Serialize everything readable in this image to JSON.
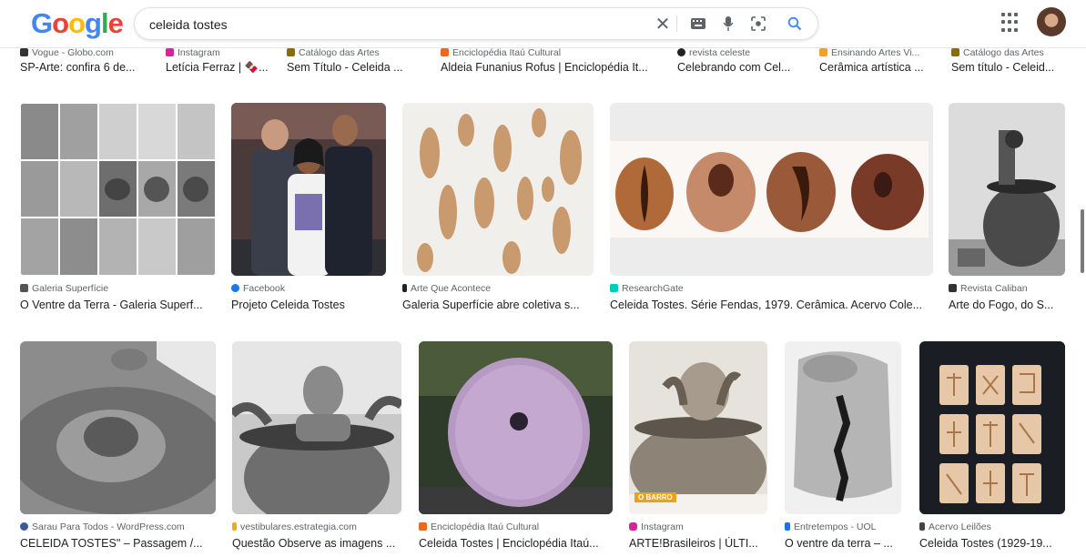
{
  "header": {
    "logo": [
      "G",
      "o",
      "o",
      "g",
      "l",
      "e"
    ],
    "query": "celeida tostes",
    "icons": [
      "close-icon",
      "keyboard-icon",
      "mic-icon",
      "lens-icon",
      "search-icon"
    ]
  },
  "top_strip": [
    {
      "source": "Vogue - Globo.com",
      "title": "SP-Arte: confira 6 de...",
      "dot": "#333333"
    },
    {
      "source": "Instagram",
      "title": "Letícia Ferraz | 🍫...",
      "dot": "#d6249f"
    },
    {
      "source": "Catálogo das Artes",
      "title": "Sem Título - Celeida ...",
      "dot": "#8a6d00"
    },
    {
      "source": "Enciclopédia Itaú Cultural",
      "title": "Aldeia Funanius Rofus | Enciclopédia It...",
      "dot": "#e86a20"
    },
    {
      "source": "revista celeste",
      "title": "Celebrando com Cel...",
      "dot": "#222222"
    },
    {
      "source": "Ensinando Artes Vi...",
      "title": "Cerâmica artística ...",
      "dot": "#f0a030"
    },
    {
      "source": "Catálogo das Artes",
      "title": "Sem título - Celeid...",
      "dot": "#8a6d00"
    }
  ],
  "row1": [
    {
      "source": "Galeria Superfície",
      "title": "O Ventre da Terra - Galeria Superf...",
      "dot": "#555555"
    },
    {
      "source": "Facebook",
      "title": "Projeto Celeida Tostes",
      "dot": "#1877f2"
    },
    {
      "source": "Arte Que Acontece",
      "title": "Galeria Superfície abre coletiva s...",
      "dot": "#222222"
    },
    {
      "source": "ResearchGate",
      "title": "Celeida Tostes. Série Fendas, 1979. Cerâmica. Acervo Cole...",
      "dot": "#00ccbb"
    },
    {
      "source": "Revista Caliban",
      "title": "Arte do Fogo, do S...",
      "dot": "#333333"
    }
  ],
  "row2": [
    {
      "source": "Sarau Para Todos - WordPress.com",
      "title": "CELEIDA TOSTES\" – Passagem /...",
      "dot": "#3b5998"
    },
    {
      "source": "vestibulares.estrategia.com",
      "title": "Questão Observe as imagens ...",
      "dot": "#f5a623"
    },
    {
      "source": "Enciclopédia Itaú Cultural",
      "title": "Celeida Tostes | Enciclopédia Itaú...",
      "dot": "#e86a20"
    },
    {
      "source": "Instagram",
      "title": "ARTE!Brasileiros | ÚLTI...",
      "dot": "#d6249f"
    },
    {
      "source": "Entretempos - UOL",
      "title": "O ventre da terra – ...",
      "dot": "#1a73e8"
    },
    {
      "source": "Acervo Leilões",
      "title": "Celeida Tostes (1929-19...",
      "dot": "#444444"
    }
  ],
  "overlays": {
    "barro_tag": "O BARRO"
  }
}
